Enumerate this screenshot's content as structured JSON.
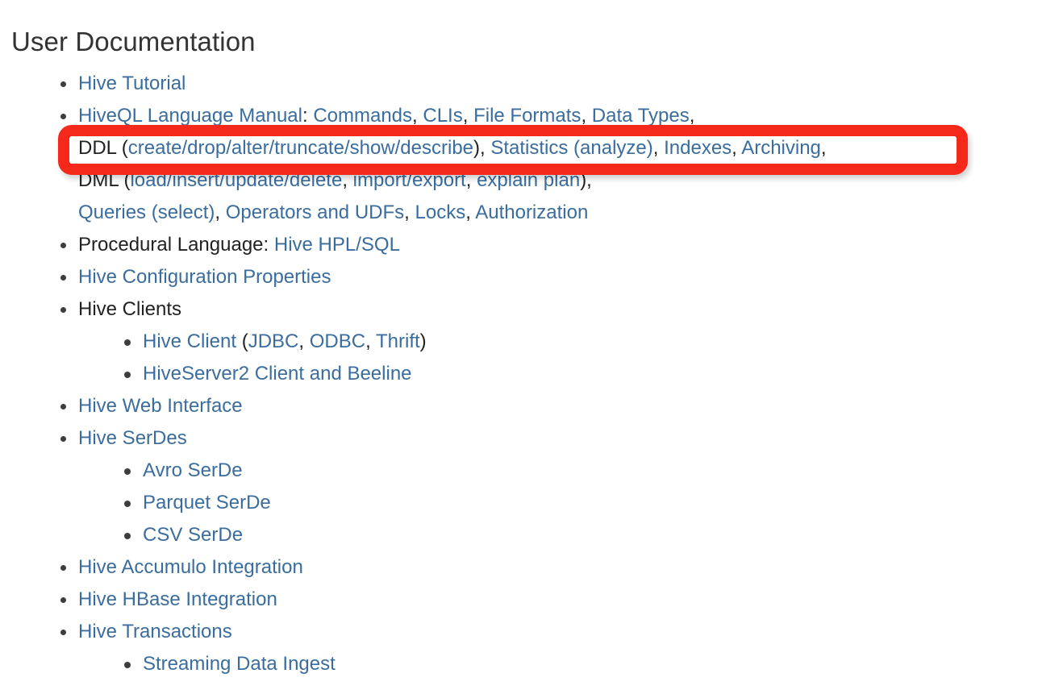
{
  "page": {
    "title": "User Documentation",
    "link_color": "#3a6d9e",
    "text_color": "#222222",
    "title_color": "#333333",
    "background_color": "#ffffff"
  },
  "annotation": {
    "type": "rounded-rectangle-highlight",
    "color": "#f4291b",
    "target_line": "DDL (create/drop/alter/truncate/show/describe), Statistics (analyze), Indexes, Archiving,"
  },
  "list": {
    "items": [
      {
        "id": "hive-tutorial",
        "level": 1,
        "parts": [
          {
            "text": "Hive Tutorial",
            "link": true
          }
        ]
      },
      {
        "id": "hiveql-language-manual",
        "level": 1,
        "parts": [
          {
            "text": "HiveQL Language Manual",
            "link": true
          },
          {
            "text": ":  ",
            "link": false
          },
          {
            "text": "Commands",
            "link": true
          },
          {
            "text": ", ",
            "link": false
          },
          {
            "text": "CLIs",
            "link": true
          },
          {
            "text": ", ",
            "link": false
          },
          {
            "text": "File Formats",
            "link": true
          },
          {
            "text": ", ",
            "link": false
          },
          {
            "text": "Data Types",
            "link": true
          },
          {
            "text": ",",
            "link": false
          }
        ]
      },
      {
        "id": "ddl-line",
        "level": 1,
        "continuation": true,
        "highlighted": true,
        "parts": [
          {
            "text": "DDL ",
            "link": false
          },
          {
            "text": "(",
            "link": false
          },
          {
            "text": "create/drop/alter/truncate/show/describe",
            "link": true
          },
          {
            "text": "), ",
            "link": false
          },
          {
            "text": "Statistics (analyze)",
            "link": true
          },
          {
            "text": ", ",
            "link": false
          },
          {
            "text": "Indexes",
            "link": true
          },
          {
            "text": ", ",
            "link": false
          },
          {
            "text": "Archiving",
            "link": true
          },
          {
            "text": ",",
            "link": false
          }
        ]
      },
      {
        "id": "dml-line",
        "level": 1,
        "continuation": true,
        "parts": [
          {
            "text": "DML ",
            "link": false
          },
          {
            "text": "(",
            "link": false
          },
          {
            "text": "load/insert/update/delete",
            "link": true
          },
          {
            "text": ", ",
            "link": false
          },
          {
            "text": "import/export",
            "link": true
          },
          {
            "text": ", ",
            "link": false
          },
          {
            "text": "explain plan",
            "link": true
          },
          {
            "text": "),",
            "link": false
          }
        ]
      },
      {
        "id": "queries-line",
        "level": 1,
        "continuation": true,
        "parts": [
          {
            "text": "Queries (select)",
            "link": true
          },
          {
            "text": ", ",
            "link": false
          },
          {
            "text": "Operators and UDFs",
            "link": true
          },
          {
            "text": ", ",
            "link": false
          },
          {
            "text": "Locks",
            "link": true
          },
          {
            "text": ", ",
            "link": false
          },
          {
            "text": "Authorization",
            "link": true
          }
        ]
      },
      {
        "id": "procedural-language",
        "level": 1,
        "parts": [
          {
            "text": "Procedural Language:  ",
            "link": false
          },
          {
            "text": "Hive HPL/SQL",
            "link": true
          }
        ]
      },
      {
        "id": "hive-configuration-properties",
        "level": 1,
        "parts": [
          {
            "text": "Hive Configuration Properties",
            "link": true
          }
        ]
      },
      {
        "id": "hive-clients",
        "level": 1,
        "parts": [
          {
            "text": "Hive Clients",
            "link": false
          }
        ]
      },
      {
        "id": "hive-client",
        "level": 2,
        "parts": [
          {
            "text": "Hive Client",
            "link": true
          },
          {
            "text": " (",
            "link": false
          },
          {
            "text": "JDBC",
            "link": true
          },
          {
            "text": ", ",
            "link": false
          },
          {
            "text": "ODBC",
            "link": true
          },
          {
            "text": ", ",
            "link": false
          },
          {
            "text": "Thrift",
            "link": true
          },
          {
            "text": ")",
            "link": false
          }
        ]
      },
      {
        "id": "hiveserver2-client-and-beeline",
        "level": 2,
        "parts": [
          {
            "text": "HiveServer2 Client and Beeline",
            "link": true
          }
        ]
      },
      {
        "id": "hive-web-interface",
        "level": 1,
        "parts": [
          {
            "text": "Hive Web Interface",
            "link": true
          }
        ]
      },
      {
        "id": "hive-serdes",
        "level": 1,
        "parts": [
          {
            "text": "Hive SerDes",
            "link": true
          }
        ]
      },
      {
        "id": "avro-serde",
        "level": 2,
        "parts": [
          {
            "text": "Avro SerDe",
            "link": true
          }
        ]
      },
      {
        "id": "parquet-serde",
        "level": 2,
        "parts": [
          {
            "text": "Parquet SerDe",
            "link": true
          }
        ]
      },
      {
        "id": "csv-serde",
        "level": 2,
        "parts": [
          {
            "text": "CSV SerDe",
            "link": true
          }
        ]
      },
      {
        "id": "hive-accumulo-integration",
        "level": 1,
        "parts": [
          {
            "text": "Hive Accumulo Integration",
            "link": true
          }
        ]
      },
      {
        "id": "hive-hbase-integration",
        "level": 1,
        "parts": [
          {
            "text": "Hive HBase Integration",
            "link": true
          }
        ]
      },
      {
        "id": "hive-transactions",
        "level": 1,
        "parts": [
          {
            "text": "Hive Transactions",
            "link": true
          }
        ]
      },
      {
        "id": "streaming-data-ingest",
        "level": 2,
        "parts": [
          {
            "text": "Streaming Data Ingest",
            "link": true
          }
        ]
      }
    ]
  }
}
